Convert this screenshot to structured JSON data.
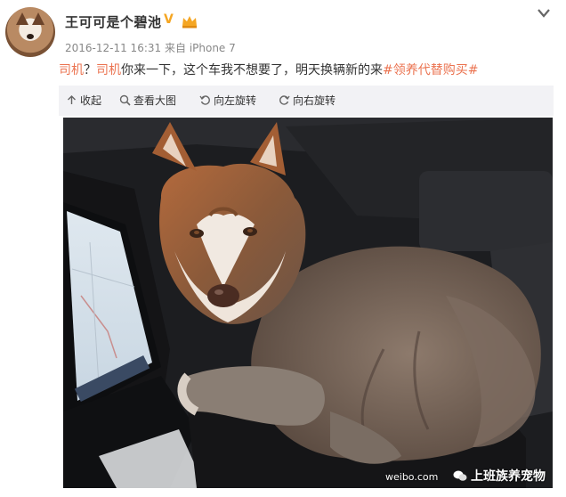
{
  "header": {
    "username": "王可可是个碧池",
    "verified_badge": "V",
    "date": "2016-12-11 16:31",
    "source_prefix": "来自",
    "device": "iPhone 7"
  },
  "post": {
    "mention1": "司机",
    "sep": "？",
    "mention2": "司机",
    "body": "你来一下，这个车我不想要了，明天换辆新的来",
    "hashtag": "#领养代替购买#"
  },
  "toolbar": {
    "collapse": "收起",
    "view_large": "查看大图",
    "rotate_left": "向左旋转",
    "rotate_right": "向右旋转"
  },
  "photo": {
    "weibo_text": "weibo.com",
    "watermark": "上班族养宠物"
  },
  "icons": {
    "verified": "crown-icon",
    "menu": "chevron-down-icon"
  },
  "colors": {
    "link": "#eb7350",
    "toolbar_bg": "#f2f2f5",
    "badge": "#f5a623"
  }
}
